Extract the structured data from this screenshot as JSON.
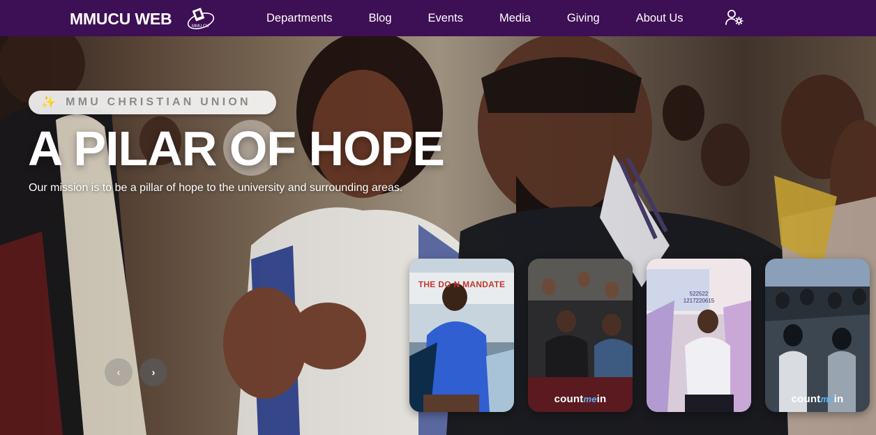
{
  "navbar": {
    "brand": "MMUCU WEB",
    "links": [
      "Departments",
      "Blog",
      "Events",
      "Media",
      "Giving",
      "About Us"
    ],
    "icons": {
      "logo": "mmu-cu-logo",
      "user": "user-settings-icon"
    }
  },
  "hero": {
    "badge_icon": "✨",
    "badge": "MMU CHRISTIAN UNION",
    "title": "A PILAR OF HOPE",
    "subtitle": "Our mission is to be a pillar of hope to the university and surrounding areas.",
    "prev_label": "‹",
    "next_label": "›"
  },
  "thumbnails": [
    {
      "banner": "THE DO   N MANDATE",
      "caption_pre": "",
      "caption_me": "",
      "caption_post": ""
    },
    {
      "banner": "",
      "caption_pre": "count",
      "caption_me": "me",
      "caption_post": "in"
    },
    {
      "screen": "522522\n1217220615",
      "caption_pre": "",
      "caption_me": "",
      "caption_post": ""
    },
    {
      "banner": "",
      "caption_pre": "count",
      "caption_me": "me",
      "caption_post": "in"
    }
  ],
  "colors": {
    "navbar": "#3d0f55",
    "badge_bg": "#ffffff",
    "badge_text": "#8a8a8a",
    "accent_blue": "#5ab4ff"
  }
}
